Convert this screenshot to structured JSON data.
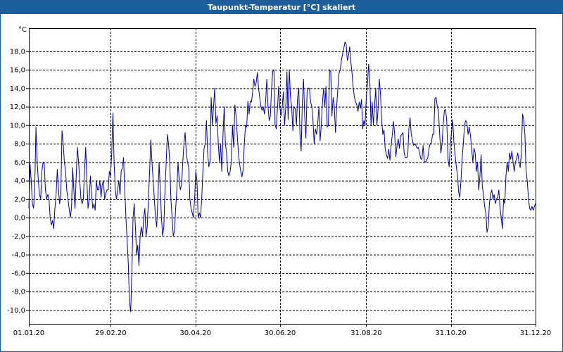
{
  "window": {
    "title": "Taupunkt-Temperatur [°C] skaliert"
  },
  "colors": {
    "titlebar": "#1b5f9d",
    "line": "#0000b0",
    "grid": "#000000",
    "plot_bg": "#ffffff"
  },
  "chart_data": {
    "type": "line",
    "title": "Taupunkt-Temperatur [°C] skaliert",
    "ylabel": "°C",
    "xlabel": "",
    "ylim": [
      -11.5,
      20.5
    ],
    "xlim": [
      "2020-01-01",
      "2020-12-31"
    ],
    "grid": true,
    "y_ticks": [
      "18,0",
      "16,0",
      "14,0",
      "12,0",
      "10,0",
      "8,0",
      "6,0",
      "4,0",
      "2,0",
      "0,0",
      "-2,0",
      "-4,0",
      "-6,0",
      "-8,0",
      "-10,0"
    ],
    "y_tick_values": [
      18,
      16,
      14,
      12,
      10,
      8,
      6,
      4,
      2,
      0,
      -2,
      -4,
      -6,
      -8,
      -10
    ],
    "x_ticks": [
      "01.01.20",
      "29.02.20",
      "30.04.20",
      "30.06.20",
      "31.08.20",
      "31.10.20",
      "31.12.20"
    ],
    "x_tick_dates": [
      "2020-01-01",
      "2020-02-29",
      "2020-04-30",
      "2020-06-30",
      "2020-08-31",
      "2020-10-31",
      "2020-12-31"
    ],
    "series": [
      {
        "x_start": "2020-01-01",
        "x_step_days": 1,
        "values": [
          1,
          5.8,
          4,
          1.5,
          1,
          3.5,
          9.8,
          6,
          4,
          2.5,
          2,
          5,
          6,
          5.8,
          3,
          2,
          2.5,
          2,
          0,
          -0.8,
          -0.3,
          -1.2,
          1,
          2.5,
          5.2,
          3,
          1.5,
          2.5,
          9.4,
          8,
          6,
          5,
          3,
          2,
          1,
          0,
          1,
          5.4,
          3,
          1,
          4.5,
          7.6,
          6,
          4,
          2,
          1.5,
          2,
          5,
          7.6,
          4,
          1,
          2,
          4.5,
          2.5,
          1,
          1.5,
          0.8,
          4,
          3,
          3,
          4,
          2.2,
          3.6,
          4,
          2,
          2.6,
          3,
          3,
          5,
          4.5,
          7,
          11.3,
          6,
          3,
          2,
          3,
          4,
          2.5,
          5,
          5.4,
          6.5,
          3,
          0,
          -2.5,
          -5,
          -9.2,
          -10.2,
          -6,
          0,
          1.5,
          -1,
          -4,
          -3,
          -5.2,
          -2,
          -1,
          -2,
          0,
          1,
          -2,
          -1,
          2,
          5,
          8.4,
          6,
          4,
          2,
          0,
          -1,
          2,
          6,
          3,
          0,
          -2,
          -1,
          3,
          6,
          9,
          8,
          6,
          2,
          0,
          -2,
          -1.5,
          1,
          3,
          6,
          4,
          3,
          3.6,
          6,
          8,
          9.2,
          7,
          6,
          5.5,
          2,
          1,
          0.5,
          0,
          2,
          5,
          4,
          0,
          0.5,
          0,
          2,
          5,
          7.5,
          8,
          10.5,
          7,
          5.5,
          6,
          13,
          10,
          12,
          14,
          10.2,
          11,
          8,
          6,
          8,
          5,
          9,
          12,
          8,
          7,
          5,
          4.5,
          5,
          6,
          10,
          7.6,
          12.2,
          11,
          9,
          7,
          5.8,
          5,
          4.4,
          5.2,
          8,
          10,
          9.8,
          12.6,
          11.2,
          12.6,
          12.5,
          13.5,
          15,
          14.2,
          14.6,
          15.7,
          14,
          13,
          12,
          11.6,
          12,
          11.2,
          12.6,
          15,
          12,
          10.5,
          11,
          14,
          15.8,
          16,
          10,
          9.6,
          11.8,
          14.2,
          12,
          11,
          12,
          13.6,
          10,
          12,
          15.8,
          10.6,
          16,
          13,
          12,
          9.4,
          12,
          11.8,
          10,
          13,
          14,
          9,
          7.2,
          12.5,
          15,
          11,
          8.6,
          13.6,
          14,
          14,
          12.5,
          12,
          10.5,
          8,
          9.6,
          9,
          10.2,
          12,
          8.3,
          10,
          12.5,
          14,
          12,
          14.2,
          9.8,
          10,
          16,
          15.8,
          11,
          13,
          12,
          9.2,
          12,
          14,
          15.6,
          16,
          17,
          17.7,
          18.3,
          19,
          18.8,
          17,
          17.5,
          18.5,
          16.8,
          15.6,
          14,
          13,
          12.5,
          12.2,
          11.5,
          12.5,
          11.8,
          12.8,
          9.6,
          10.5,
          10,
          13,
          14.4,
          16.6,
          15,
          10,
          12.5,
          10,
          12,
          14,
          10,
          11.8,
          15,
          13.4,
          10.5,
          9,
          9.5,
          7.4,
          6.8,
          6.4,
          7.4,
          6.2,
          7.8,
          9,
          10.4,
          9,
          6.6,
          7.8,
          8.5,
          7.5,
          8.8,
          9,
          9.2,
          7,
          6.5,
          6.5,
          6.6,
          9.6,
          10.8,
          9,
          8.4,
          7.8,
          8,
          7.8,
          7.5,
          7.6,
          7,
          6.4,
          6.3,
          7.8,
          6.1,
          6,
          6.2,
          6.5,
          7.5,
          8,
          8.1,
          9,
          9,
          12.9,
          13,
          12,
          11.5,
          9,
          7,
          8,
          10.1,
          11.6,
          11.7,
          10.5,
          6.4,
          5.5,
          7.9,
          9.2,
          10.6,
          8.2,
          6.8,
          5.6,
          4.6,
          2.8,
          2.2,
          4,
          6.5,
          8,
          10,
          10.5,
          10.3,
          9,
          9.8,
          8.9,
          7.5,
          6,
          7.5,
          7,
          5,
          6,
          3,
          4.5,
          6.8,
          3.5,
          2.4,
          1.2,
          0.5,
          -1.6,
          -1,
          1.5,
          2.5,
          3,
          2,
          2.5,
          1.5,
          2,
          2.2,
          3,
          1,
          0,
          -1.2,
          2,
          1.5,
          4.5,
          6,
          5,
          7,
          6.3,
          7.2,
          6,
          5,
          6,
          6.4,
          7,
          6,
          5.4,
          7,
          11.2,
          10.6,
          9,
          5,
          4,
          2,
          1,
          0.8,
          1.2,
          0.8,
          1.2,
          1.5
        ]
      }
    ]
  }
}
